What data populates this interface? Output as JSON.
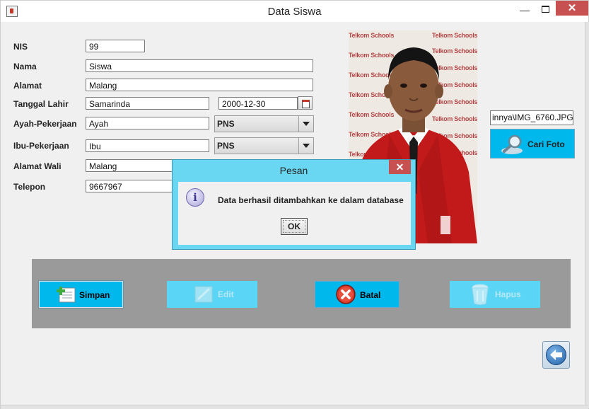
{
  "window": {
    "title": "Data Siswa",
    "minimize_glyph": "—",
    "close_glyph": "✕",
    "icon": "java-app-icon"
  },
  "form": {
    "nis": {
      "label": "NIS",
      "value": "99"
    },
    "nama": {
      "label": "Nama",
      "value": "Siswa"
    },
    "alamat": {
      "label": "Alamat",
      "value": "Malang"
    },
    "tanggal_lahir": {
      "label": "Tanggal Lahir",
      "place": "Samarinda",
      "date": "2000-12-30"
    },
    "ayah": {
      "label": "Ayah-Pekerjaan",
      "name": "Ayah",
      "job": "PNS"
    },
    "ibu": {
      "label": "Ibu-Pekerjaan",
      "name": "Ibu",
      "job": "PNS"
    },
    "wali": {
      "label": "Alamat Wali",
      "value": "Malang"
    },
    "telepon": {
      "label": "Telepon",
      "value": "9667967"
    }
  },
  "photo": {
    "file_path": "innya\\IMG_6760.JPG",
    "browse_label": "Cari Foto",
    "watermark": "Telkom Schools"
  },
  "actions": {
    "simpan": "Simpan",
    "edit": "Edit",
    "batal": "Batal",
    "hapus": "Hapus"
  },
  "dialog": {
    "title": "Pesan",
    "message": "Data berhasil ditambahkan ke dalam database",
    "ok_label": "OK",
    "close_glyph": "✕",
    "icon_glyph": "i"
  },
  "colors": {
    "button_accent": "#00b8ec",
    "button_disabled": "#5ad5f5",
    "dialog_frame": "#69d7f2",
    "close_red": "#c75050",
    "panel_gray": "#9a9a9a"
  }
}
